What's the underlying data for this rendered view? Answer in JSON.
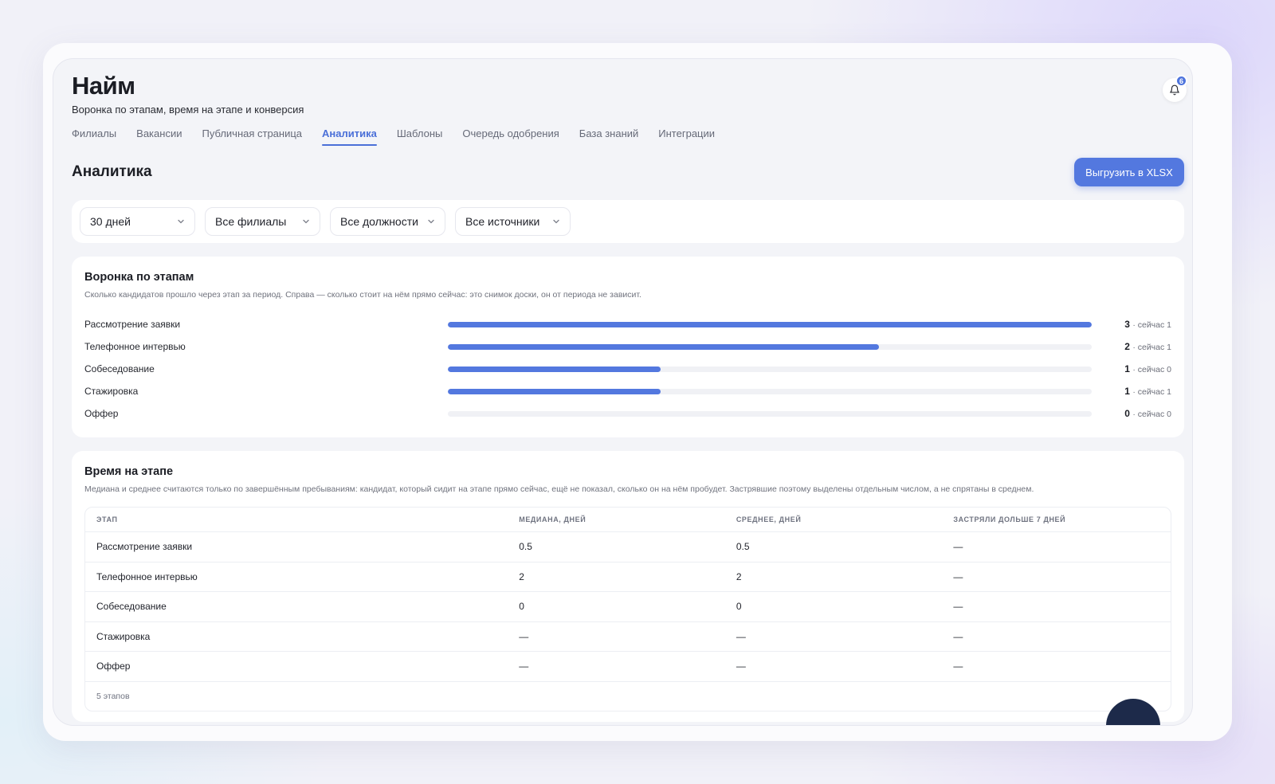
{
  "header": {
    "title": "Найм",
    "subtitle": "Воронка по этапам, время на этапе и конверсия",
    "notifications_count": "6"
  },
  "tabs": [
    {
      "label": "Филиалы",
      "active": false
    },
    {
      "label": "Вакансии",
      "active": false
    },
    {
      "label": "Публичная страница",
      "active": false
    },
    {
      "label": "Аналитика",
      "active": true
    },
    {
      "label": "Шаблоны",
      "active": false
    },
    {
      "label": "Очередь одобрения",
      "active": false
    },
    {
      "label": "База знаний",
      "active": false
    },
    {
      "label": "Интеграции",
      "active": false
    }
  ],
  "section": {
    "title": "Аналитика",
    "export_label": "Выгрузить в XLSX"
  },
  "filters": [
    {
      "value": "30 дней"
    },
    {
      "value": "Все филиалы"
    },
    {
      "value": "Все должности"
    },
    {
      "value": "Все источники"
    }
  ],
  "funnel": {
    "title": "Воронка по этапам",
    "description": "Сколько кандидатов прошло через этап за период. Справа — сколько стоит на нём прямо сейчас: это снимок доски, он от периода не зависит.",
    "stages": [
      {
        "name": "Рассмотрение заявки",
        "count": "3",
        "now": "· сейчас 1",
        "fraction": 1.0
      },
      {
        "name": "Телефонное интервью",
        "count": "2",
        "now": "· сейчас 1",
        "fraction": 0.67
      },
      {
        "name": "Собеседование",
        "count": "1",
        "now": "· сейчас 0",
        "fraction": 0.33
      },
      {
        "name": "Стажировка",
        "count": "1",
        "now": "· сейчас 1",
        "fraction": 0.33
      },
      {
        "name": "Оффер",
        "count": "0",
        "now": "· сейчас 0",
        "fraction": 0.0
      }
    ]
  },
  "time_on_stage": {
    "title": "Время на этапе",
    "description": "Медиана и среднее считаются только по завершённым пребываниям: кандидат, который сидит на этапе прямо сейчас, ещё не показал, сколько он на нём пробудет. Застрявшие поэтому выделены отдельным числом, а не спрятаны в среднем.",
    "columns": [
      "Этап",
      "Медиана, дней",
      "Среднее, дней",
      "Застряли дольше 7 дней"
    ],
    "rows": [
      [
        "Рассмотрение заявки",
        "0.5",
        "0.5",
        "—"
      ],
      [
        "Телефонное интервью",
        "2",
        "2",
        "—"
      ],
      [
        "Собеседование",
        "0",
        "0",
        "—"
      ],
      [
        "Стажировка",
        "—",
        "—",
        "—"
      ],
      [
        "Оффер",
        "—",
        "—",
        "—"
      ]
    ],
    "footer": "5 этапов"
  },
  "colors": {
    "accent": "#5378df",
    "track": "#f0f1f5"
  }
}
